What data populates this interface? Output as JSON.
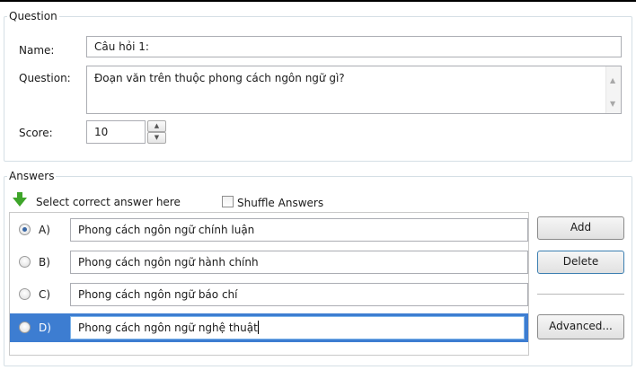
{
  "question_group": {
    "title": "Question",
    "name_label": "Name:",
    "name_value": "Câu hỏi 1:",
    "question_label": "Question:",
    "question_value": "Đoạn văn trên thuộc phong cách ngôn ngữ gì?",
    "score_label": "Score:",
    "score_value": "10"
  },
  "answers_group": {
    "title": "Answers",
    "hint": "Select correct answer here",
    "shuffle_label": "Shuffle Answers",
    "shuffle_checked": false,
    "items": [
      {
        "letter": "A)",
        "text": "Phong cách ngôn ngữ chính luận",
        "correct": true
      },
      {
        "letter": "B)",
        "text": "Phong cách ngôn ngữ hành chính",
        "correct": false
      },
      {
        "letter": "C)",
        "text": "Phong cách ngôn ngữ báo chí",
        "correct": false
      },
      {
        "letter": "D)",
        "text": "Phong cách ngôn ngữ nghệ thuật",
        "correct": false,
        "selected": true
      }
    ]
  },
  "buttons": {
    "add": "Add",
    "delete": "Delete",
    "advanced": "Advanced..."
  }
}
